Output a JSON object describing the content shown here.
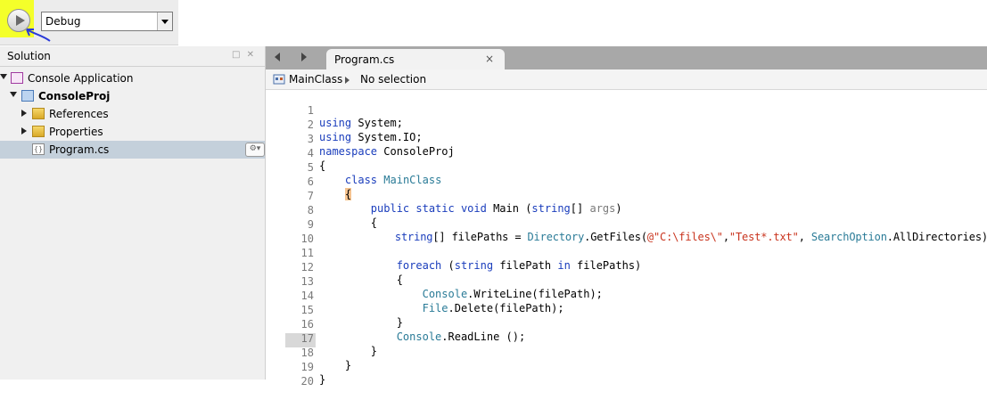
{
  "toolbar": {
    "config_value": "Debug"
  },
  "solution": {
    "title": "Solution",
    "pane_controls": "□ ✕",
    "items": [
      {
        "label": "Console Application"
      },
      {
        "label": "ConsoleProj"
      },
      {
        "label": "References"
      },
      {
        "label": "Properties"
      },
      {
        "label": "Program.cs"
      }
    ]
  },
  "editor": {
    "tab_label": "Program.cs",
    "tab_close": "×",
    "breadcrumb_class": "MainClass",
    "breadcrumb_member": "No selection",
    "line_numbers": [
      "1",
      "2",
      "3",
      "4",
      "5",
      "6",
      "7",
      "8",
      "9",
      "10",
      "11",
      "12",
      "13",
      "14",
      "15",
      "16",
      "17",
      "18",
      "19",
      "20"
    ],
    "code": {
      "l1": [
        "using",
        " System;"
      ],
      "l2": [
        "using",
        " System.IO;"
      ],
      "l3": [
        "namespace",
        " ConsoleProj"
      ],
      "l4": [
        "{"
      ],
      "l5": [
        "    ",
        "class",
        " ",
        "MainClass"
      ],
      "l6": [
        "    ",
        "{"
      ],
      "l7": [
        "        ",
        "public static void",
        " Main (",
        "string",
        "[] ",
        "args",
        ")"
      ],
      "l8": [
        "        {"
      ],
      "l9": [
        "            ",
        "string",
        "[] filePaths = ",
        "Directory",
        ".GetFiles(",
        "@\"C:\\files\\\"",
        ",",
        "\"Test*.txt\"",
        ", ",
        "SearchOption",
        ".AllDirectories);"
      ],
      "l11": [
        "            ",
        "foreach",
        " (",
        "string",
        " filePath ",
        "in",
        " filePaths)"
      ],
      "l12": [
        "            {"
      ],
      "l13": [
        "                ",
        "Console",
        ".WriteLine(filePath);"
      ],
      "l14": [
        "                ",
        "File",
        ".Delete(filePath);"
      ],
      "l15": [
        "            }"
      ],
      "l16": [
        "            ",
        "Console",
        ".ReadLine ();"
      ],
      "l17": [
        "        }"
      ],
      "l18": [
        "    }"
      ],
      "l19": [
        "}"
      ]
    }
  },
  "colors": {
    "highlight": "#f4ff2a",
    "keyword": "#1a3dbc",
    "type": "#2a7b97",
    "string": "#c9341e",
    "selection": "#c4d0db",
    "annotation_arrow": "#2a3ad8"
  },
  "icons": {
    "run": "play-triangle-icon",
    "arrow": "hand-drawn-arrow-icon",
    "solution": "solution-icon",
    "project": "project-icon",
    "folder": "folder-icon",
    "file": "csharp-file-icon",
    "class": "class-icon",
    "gear": "gear-icon"
  }
}
